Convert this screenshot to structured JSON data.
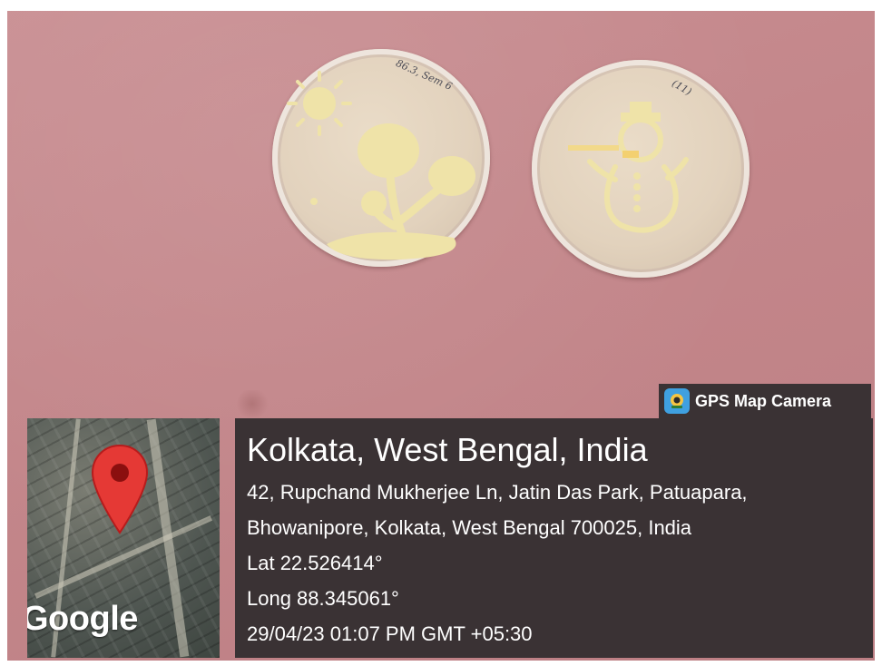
{
  "dish_labels": {
    "left": "86.3, Sem 6",
    "right": "(11)"
  },
  "badge": {
    "text": "GPS Map Camera",
    "icon": "gps-map-camera-logo-icon"
  },
  "map": {
    "watermark": "Google",
    "pin_icon": "map-pin-icon",
    "pin_color": "#e53935"
  },
  "location": {
    "title": "Kolkata, West Bengal, India",
    "address_line1": "42, Rupchand Mukherjee Ln, Jatin Das Park, Patuapara,",
    "address_line2": "Bhowanipore, Kolkata, West Bengal 700025, India",
    "latitude": "Lat 22.526414°",
    "longitude": "Long 88.345061°",
    "timestamp": "29/04/23 01:07 PM GMT +05:30"
  },
  "colors": {
    "panel_bg": "#3a3234",
    "surface": "#c4878b",
    "culture": "#efe3a8"
  }
}
